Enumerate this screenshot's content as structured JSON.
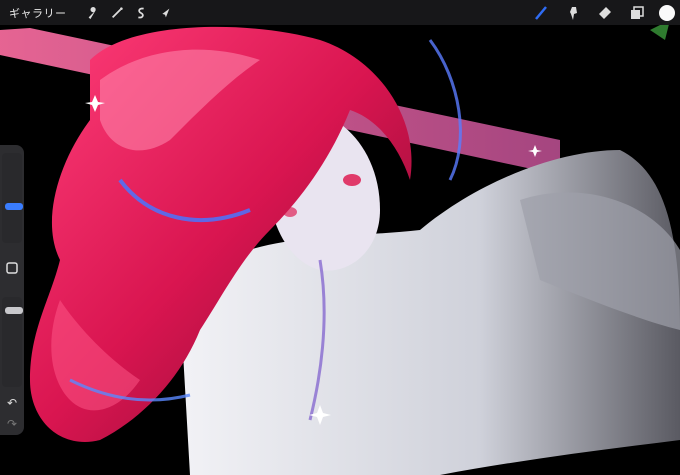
{
  "toolbar": {
    "gallery_label": "ギャラリー",
    "left_tools": [
      "wrench-icon",
      "magic-wand-icon",
      "selection-s-icon",
      "transform-arrow-icon"
    ],
    "right_tools": [
      "brush-icon",
      "smudge-icon",
      "eraser-icon",
      "layers-icon"
    ],
    "active_tool": "brush-icon",
    "accent_color": "#2f6cf4",
    "current_color": "#fafafa"
  },
  "sidebar": {
    "brush_size_level": 0.35,
    "opacity_level": 0.45,
    "modify_button": "square-button-icon",
    "undo_icon": "undo-icon",
    "redo_icon": "redo-icon"
  },
  "artwork": {
    "description_colors": {
      "hair": "#e0205a",
      "hair_light": "#ff7aa0",
      "coat": "#d8dbe6",
      "background": "#000000",
      "accent": "#3b6cf0"
    }
  }
}
